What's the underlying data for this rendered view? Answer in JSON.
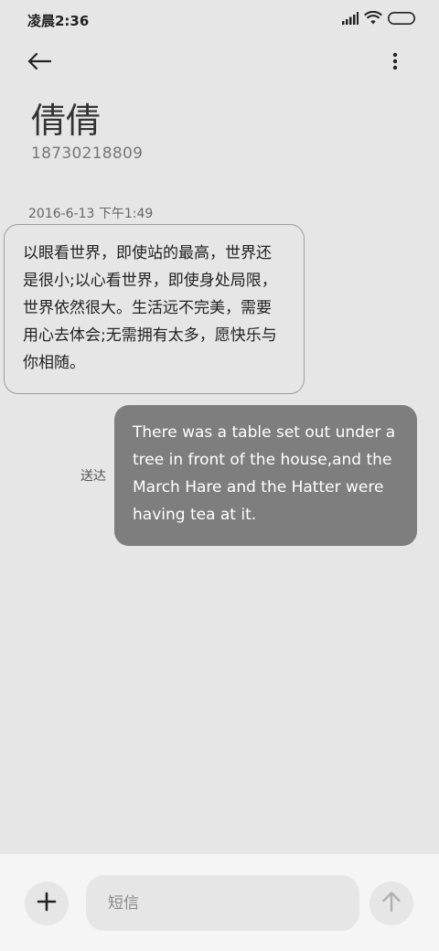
{
  "status_bar": {
    "time": "凌晨2:36",
    "icons": [
      "signal-icon",
      "wifi-icon",
      "battery-icon"
    ]
  },
  "header": {
    "back_icon": "arrow-left-icon",
    "more_icon": "more-vertical-icon"
  },
  "contact": {
    "name": "倩倩",
    "number": "18730218809"
  },
  "conversation": {
    "date_stamp": "2016-6-13 下午1:49",
    "incoming": {
      "text": "以眼看世界，即使站的最高，世界还是很小;以心看世界，即使身处局限，世界依然很大。生活远不完美，需要用心去体会;无需拥有太多，愿快乐与你相随。"
    },
    "outgoing": {
      "text": "There was a table set out under a tree in front of the house,and the March Hare and the Hatter were having tea at it.",
      "status": "送达"
    }
  },
  "composer": {
    "placeholder": "短信",
    "value": "",
    "add_icon": "plus-icon",
    "send_icon": "arrow-up-icon"
  },
  "colors": {
    "background": "#e6e6e6",
    "outgoing_bubble": "#7e7e7e",
    "composer_bar": "#f5f5f5"
  }
}
